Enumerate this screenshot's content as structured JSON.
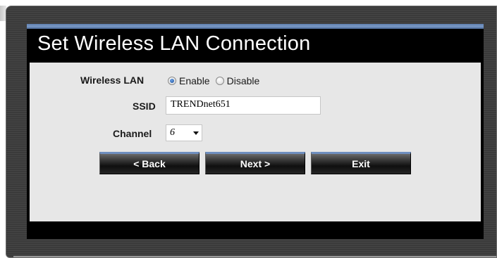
{
  "dialog": {
    "title": "Set Wireless LAN Connection"
  },
  "form": {
    "wireless_lan_label": "Wireless LAN",
    "wireless_lan_options": [
      {
        "label": "Enable",
        "checked": true
      },
      {
        "label": "Disable",
        "checked": false
      }
    ],
    "ssid_label": "SSID",
    "ssid_value": "TRENDnet651",
    "channel_label": "Channel",
    "channel_value": "6"
  },
  "buttons": {
    "back": "< Back",
    "next": "Next >",
    "exit": "Exit"
  },
  "colors": {
    "accent_topline": "#6f8fbf",
    "content_background": "#e7e7e7",
    "dialog_background": "#000000"
  }
}
